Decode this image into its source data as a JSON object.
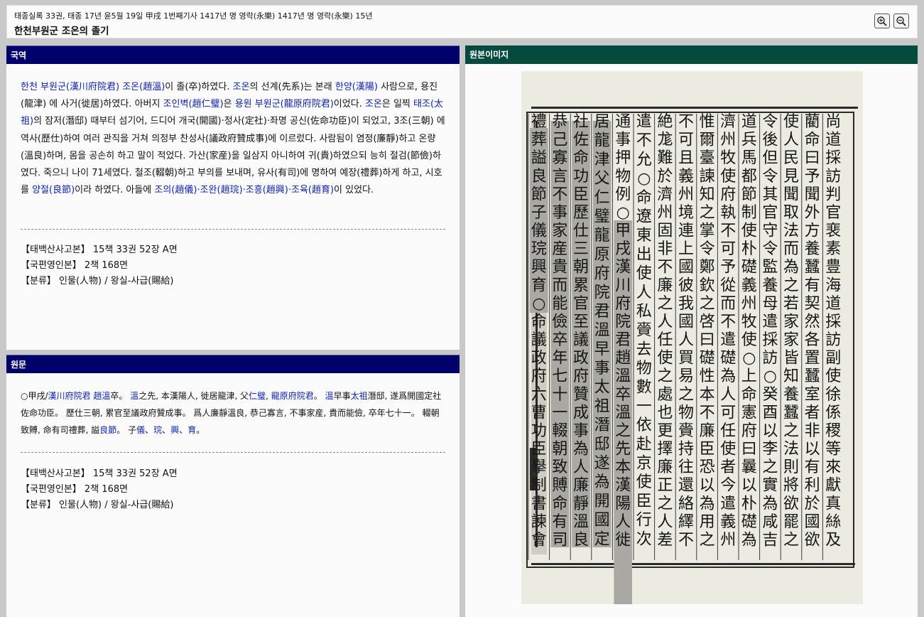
{
  "header": {
    "breadcrumb": "태종실록 33권, 태종 17년 윤5월 19일 甲戌 1번째기사 1417년 명 영락(永樂) 1417년 명 영락(永樂) 15년",
    "title": "한천부원군 조온의 졸기",
    "zoom_in_icon": "zoom-in-icon",
    "zoom_out_icon": "zoom-out-icon"
  },
  "translation": {
    "heading": "국역",
    "paragraph": [
      {
        "t": "한천 부원군(漢川府院君) 조온(趙溫)",
        "link": true
      },
      {
        "t": "이 졸(卒)하였다. ",
        "link": false
      },
      {
        "t": "조온",
        "link": true
      },
      {
        "t": "의 선계(先系)는 본래 ",
        "link": false
      },
      {
        "t": "한양(漢陽)",
        "link": true
      },
      {
        "t": " 사람으로, 용진(龍津) 에 사거(徙居)하였다. 아버지 ",
        "link": false
      },
      {
        "t": "조인벽(趙仁璧)",
        "link": true
      },
      {
        "t": "은 ",
        "link": false
      },
      {
        "t": "용원 부원군(龍原府院君)",
        "link": true
      },
      {
        "t": "이었다. ",
        "link": false
      },
      {
        "t": "조온",
        "link": true
      },
      {
        "t": "은 일찍 ",
        "link": false
      },
      {
        "t": "태조(太祖)",
        "link": true
      },
      {
        "t": "의 잠저(潛邸) 때부터 섬기어, 드디어 개국(開國)·정사(定社)·좌명 공신(佐命功臣)이 되었고, 3조(三朝) 에 역사(歷仕)하여 여러 관직을 거쳐 의정부 찬성사(議政府贊成事)에 이르렀다. 사람됨이 염정(廉靜)하고 온량(溫良)하며, 몸을 공손히 하고 말이 적었다. 가산(家産)을 일삼지 아니하여 귀(貴)하였으되 능히 절검(節儉)하였다. 죽으니 나이 71세였다. 철조(輟朝)하고 부의를 보내며, 유사(有司)에 명하여 예장(禮葬)하게 하고, 시호를 ",
        "link": false
      },
      {
        "t": "양절(良節)",
        "link": true
      },
      {
        "t": "이라 하였다. 아들에 ",
        "link": false
      },
      {
        "t": "조의(趙儀)·조완(趙琓)·조흥(趙興)·조육(趙育)",
        "link": true
      },
      {
        "t": "이 있었다.",
        "link": false
      }
    ],
    "meta": [
      "【태백산사고본】 15책 33권 52장 A면",
      "【국편영인본】 2책 168면",
      "【분류】 인물(人物) / 왕실-사급(賜給)"
    ]
  },
  "original": {
    "heading": "원문",
    "paragraph": [
      {
        "t": "○甲戌/",
        "link": false
      },
      {
        "t": "漢川府院君 趙溫",
        "link": true
      },
      {
        "t": "卒。 ",
        "link": false
      },
      {
        "t": "溫",
        "link": true
      },
      {
        "t": "之先, 本漢陽人, 徙居龍津, 父",
        "link": false
      },
      {
        "t": "仁璧",
        "link": true
      },
      {
        "t": ", ",
        "link": false
      },
      {
        "t": "龍原府院君",
        "link": true
      },
      {
        "t": "。 ",
        "link": false
      },
      {
        "t": "溫",
        "link": true
      },
      {
        "t": "早事",
        "link": false
      },
      {
        "t": "太祖",
        "link": true
      },
      {
        "t": "潛邸, 遂爲開國定社佐命功臣。 歷仕三朝, 累官至議政府贊成事。 爲人廉靜溫良, 恭己寡言, 不事家産, 貴而能儉, 卒年七十一。 輟朝致賻, 命有司禮葬, 謚",
        "link": false
      },
      {
        "t": "良節",
        "link": true
      },
      {
        "t": "。 子",
        "link": false
      },
      {
        "t": "儀",
        "link": true
      },
      {
        "t": "、",
        "link": false
      },
      {
        "t": "琓",
        "link": true
      },
      {
        "t": "、",
        "link": false
      },
      {
        "t": "興",
        "link": true
      },
      {
        "t": "、",
        "link": false
      },
      {
        "t": "育",
        "link": true
      },
      {
        "t": "。",
        "link": false
      }
    ],
    "meta": [
      "【태백산사고본】 15책 33권 52장 A면",
      "【국편영인본】 2책 168면",
      "【분류】 인물(人物) / 왕실-사급(賜給)"
    ]
  },
  "image_panel": {
    "heading": "원본이미지",
    "columns": [
      "尚道採訪判官裵素豊海道採訪副使徐係稷等來獻真絲及",
      "藺命曰予聞外方養蠶有契然各置蠶室者非以有利於國欲",
      "使人民見聞取法而為之若家家皆知養蠶之法則將欲罷之",
      "令後但令其官守令監養母遣採訪○癸酉以李之實為咸吉",
      "道兵馬都節制使朴礎義州牧使○上命憲府曰曩以朴礎為",
      "濟州牧使府執不可予從而不遣礎為人可任使者今遣義州",
      "惟爾臺諫知之掌令鄭欽之啓曰礎性本不廉臣恐以為用之",
      "不可且義州境連上國彼我國人買易之物賫持往還絡繹不",
      "絶尨難於濟州固非不廉之人任使之處也更擇廉正之人差",
      "遣不允○命遼東出使人私賫去物數一依赴京使臣行次",
      "通事押物例○甲戌漢川府院君趙溫卒溫之先本漢陽人徙",
      "居龍津父仁璧龍原府院君溫早事太祖潛邸遂為開國定",
      "社佐命功臣歷仕三朝累官至議政府贊成事為人廉靜溫良",
      "恭己寡言不事家産貴而能儉卒年七十一輟朝致賻命有司",
      "禮葬謚良節子儀琓興育○命議政府六曹功臣擧制書諫會"
    ]
  }
}
